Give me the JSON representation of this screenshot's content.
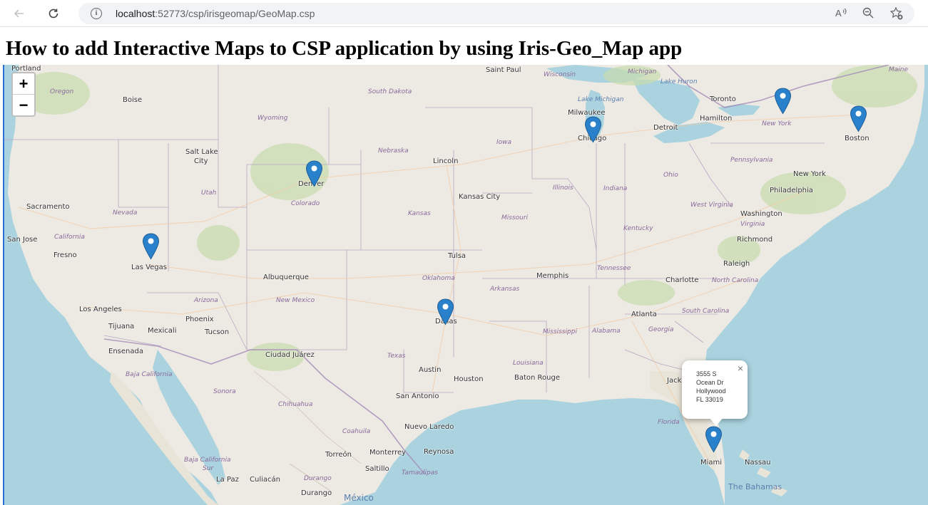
{
  "browser": {
    "url_host": "localhost",
    "url_path": ":52773/csp/irisgeomap/GeoMap.csp"
  },
  "page": {
    "title": "How to add Interactive Maps to CSP application by using Iris-Geo_Map app"
  },
  "map": {
    "zoom_in_label": "+",
    "zoom_out_label": "−",
    "marker_color": "#2a81cb",
    "markers": [
      "Denver",
      "Las Vegas",
      "Chicago",
      "New York",
      "Boston",
      "Dallas",
      "Miami"
    ],
    "popup": {
      "lines": [
        "3555 S",
        "Ocean Dr",
        "Hollywood",
        "FL 33019"
      ],
      "close": "×"
    },
    "cities": {
      "portland": "Portland",
      "boise": "Boise",
      "saint_paul": "Saint Paul",
      "milwaukee": "Milwaukee",
      "chicago": "Chicago",
      "toronto": "Toronto",
      "hamilton": "Hamilton",
      "detroit": "Detroit",
      "boston": "Boston",
      "salt_lake_city_1": "Salt Lake",
      "salt_lake_city_2": "City",
      "denver": "Denver",
      "lincoln": "Lincoln",
      "kansas_city": "Kansas City",
      "new_york": "New York",
      "philadelphia": "Philadelphia",
      "washington": "Washington",
      "richmond": "Richmond",
      "sacramento": "Sacramento",
      "san_jose": "San Jose",
      "fresno": "Fresno",
      "las_vegas": "Las Vegas",
      "albuquerque": "Albuquerque",
      "tulsa": "Tulsa",
      "memphis": "Memphis",
      "raleigh": "Raleigh",
      "charlotte": "Charlotte",
      "los_angeles": "Los Angeles",
      "phoenix": "Phoenix",
      "tijuana": "Tijuana",
      "mexicali": "Mexicali",
      "tucson": "Tucson",
      "dallas": "Dallas",
      "atlanta": "Atlanta",
      "ensenada": "Ensenada",
      "ciudad_juarez": "Ciudad Juárez",
      "austin": "Austin",
      "houston": "Houston",
      "baton_rouge": "Baton Rouge",
      "jacksonville": "Jack",
      "san_antonio": "San Antonio",
      "nuevo_laredo": "Nuevo Laredo",
      "torreon": "Torreón",
      "monterrey": "Monterrey",
      "reynosa": "Reynosa",
      "saltillo": "Saltillo",
      "la_paz": "La Paz",
      "culiacan": "Culiacán",
      "durango": "Durango",
      "miami": "Miami",
      "nassau": "Nassau"
    },
    "regions": {
      "oregon": "Oregon",
      "wyoming": "Wyoming",
      "south_dakota": "South Dakota",
      "wisconsin": "Wisconsin",
      "michigan": "Michigan",
      "maine": "Maine",
      "nebraska": "Nebraska",
      "iowa": "Iowa",
      "utah": "Utah",
      "colorado": "Colorado",
      "illinois": "Illinois",
      "indiana": "Indiana",
      "ohio": "Ohio",
      "pennsylvania": "Pennsylvania",
      "new_york_state": "New York",
      "nevada": "Nevada",
      "kansas": "Kansas",
      "missouri": "Missouri",
      "west_virginia": "West Virginia",
      "virginia": "Virginia",
      "kentucky": "Kentucky",
      "california": "California",
      "oklahoma": "Oklahoma",
      "tennessee": "Tennessee",
      "north_carolina": "North Carolina",
      "arkansas": "Arkansas",
      "arizona": "Arizona",
      "new_mexico": "New Mexico",
      "south_carolina": "South Carolina",
      "mississippi": "Mississippi",
      "alabama": "Alabama",
      "georgia": "Georgia",
      "texas": "Texas",
      "louisiana": "Louisiana",
      "baja_california": "Baja California",
      "sonora": "Sonora",
      "chihuahua": "Chihuahua",
      "coahuila": "Coahuila",
      "florida": "Florida",
      "baja_california_sur_1": "Baja California",
      "baja_california_sur_2": "Sur",
      "durango_state": "Durango",
      "tamaulipas": "Tamaulipas"
    },
    "water": {
      "lake_michigan": "Lake Michigan",
      "lake_huron": "Lake Huron",
      "mexico": "México",
      "bahamas": "The Bahamas"
    }
  }
}
